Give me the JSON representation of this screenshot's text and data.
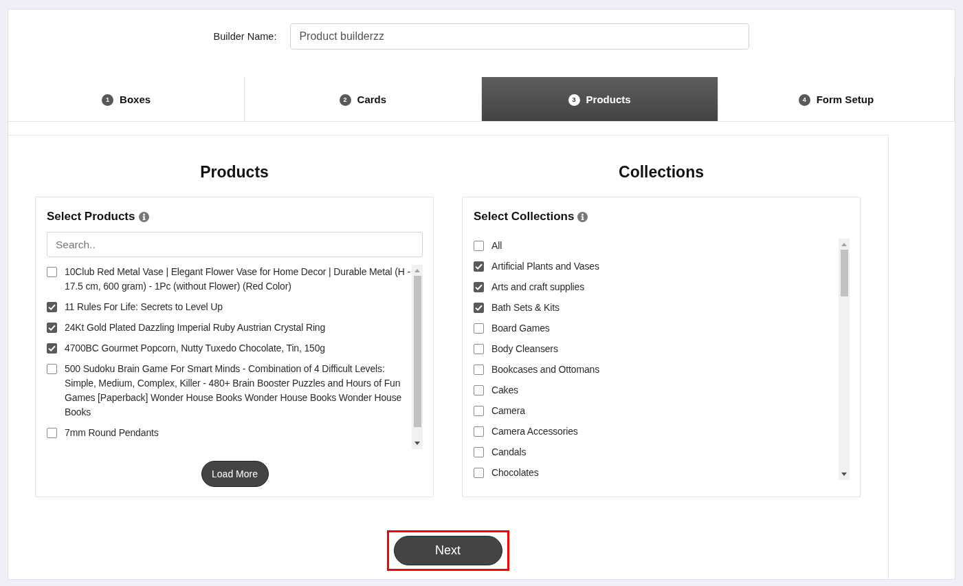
{
  "builder_name": {
    "label": "Builder Name:",
    "value": "Product builderzz"
  },
  "tabs": [
    {
      "number": "1",
      "label": "Boxes",
      "selected": false
    },
    {
      "number": "2",
      "label": "Cards",
      "selected": false
    },
    {
      "number": "3",
      "label": "Products",
      "selected": true
    },
    {
      "number": "4",
      "label": "Form Setup",
      "selected": false
    }
  ],
  "products": {
    "heading": "Products",
    "title": "Select Products",
    "search": {
      "placeholder": "Search.."
    },
    "items": [
      {
        "label": "10Club Red Metal Vase | Elegant Flower Vase for Home Decor | Durable Metal (H - 17.5 cm, 600 gram) - 1Pc (without Flower) (Red Color)",
        "checked": false
      },
      {
        "label": "11 Rules For Life: Secrets to Level Up",
        "checked": true
      },
      {
        "label": "24Kt Gold Plated Dazzling Imperial Ruby Austrian Crystal Ring",
        "checked": true
      },
      {
        "label": "4700BC Gourmet Popcorn, Nutty Tuxedo Chocolate, Tin, 150g",
        "checked": true
      },
      {
        "label": "500 Sudoku Brain Game For Smart Minds - Combination of 4 Difficult Levels: Simple, Medium, Complex, Killer - 480+ Brain Booster Puzzles and Hours of Fun Games [Paperback] Wonder House Books Wonder House Books Wonder House Books",
        "checked": false
      },
      {
        "label": "7mm Round Pendants",
        "checked": false
      }
    ],
    "load_more": "Load More"
  },
  "collections": {
    "heading": "Collections",
    "title": "Select Collections",
    "items": [
      {
        "label": "All",
        "checked": false
      },
      {
        "label": "Artificial Plants and Vases",
        "checked": true
      },
      {
        "label": "Arts and craft supplies",
        "checked": true
      },
      {
        "label": "Bath Sets & Kits",
        "checked": true
      },
      {
        "label": "Board Games",
        "checked": false
      },
      {
        "label": "Body Cleansers",
        "checked": false
      },
      {
        "label": "Bookcases and Ottomans",
        "checked": false
      },
      {
        "label": "Cakes",
        "checked": false
      },
      {
        "label": "Camera",
        "checked": false
      },
      {
        "label": "Camera Accessories",
        "checked": false
      },
      {
        "label": "Candals",
        "checked": false
      },
      {
        "label": "Chocolates",
        "checked": false
      }
    ]
  },
  "next_button": {
    "label": "Next",
    "highlighted": true
  }
}
